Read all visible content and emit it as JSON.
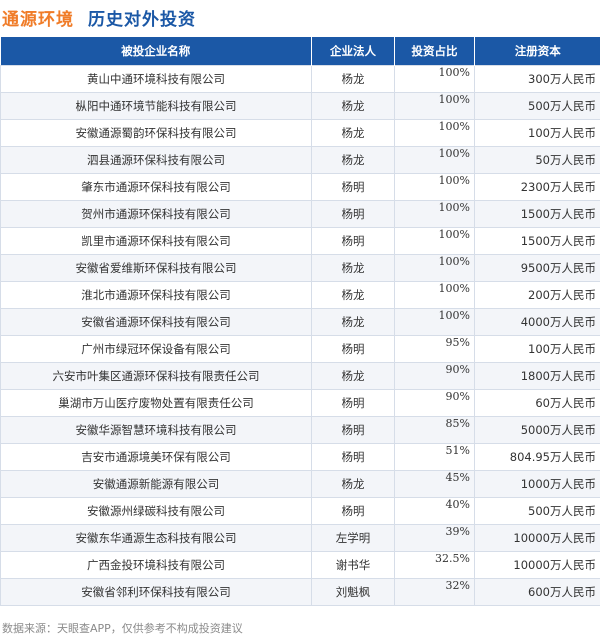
{
  "header": {
    "company": "通源环境",
    "subtitle": "历史对外投资"
  },
  "table": {
    "columns": [
      "被投企业名称",
      "企业法人",
      "投资占比",
      "注册资本"
    ],
    "rows": [
      {
        "name": "黄山中通环境科技有限公司",
        "person": "杨龙",
        "ratio": "100%",
        "capital": "300万人民币"
      },
      {
        "name": "枞阳中通环境节能科技有限公司",
        "person": "杨龙",
        "ratio": "100%",
        "capital": "500万人民币"
      },
      {
        "name": "安徽通源蜀韵环保科技有限公司",
        "person": "杨龙",
        "ratio": "100%",
        "capital": "100万人民币"
      },
      {
        "name": "泗县通源环保科技有限公司",
        "person": "杨龙",
        "ratio": "100%",
        "capital": "50万人民币"
      },
      {
        "name": "肇东市通源环保科技有限公司",
        "person": "杨明",
        "ratio": "100%",
        "capital": "2300万人民币"
      },
      {
        "name": "贺州市通源环保科技有限公司",
        "person": "杨明",
        "ratio": "100%",
        "capital": "1500万人民币"
      },
      {
        "name": "凯里市通源环保科技有限公司",
        "person": "杨明",
        "ratio": "100%",
        "capital": "1500万人民币"
      },
      {
        "name": "安徽省爱维斯环保科技有限公司",
        "person": "杨龙",
        "ratio": "100%",
        "capital": "9500万人民币"
      },
      {
        "name": "淮北市通源环保科技有限公司",
        "person": "杨龙",
        "ratio": "100%",
        "capital": "200万人民币"
      },
      {
        "name": "安徽省通源环保科技有限公司",
        "person": "杨龙",
        "ratio": "100%",
        "capital": "4000万人民币"
      },
      {
        "name": "广州市绿冠环保设备有限公司",
        "person": "杨明",
        "ratio": "95%",
        "capital": "100万人民币"
      },
      {
        "name": "六安市叶集区通源环保科技有限责任公司",
        "person": "杨龙",
        "ratio": "90%",
        "capital": "1800万人民币"
      },
      {
        "name": "巢湖市万山医疗废物处置有限责任公司",
        "person": "杨明",
        "ratio": "90%",
        "capital": "60万人民币"
      },
      {
        "name": "安徽华源智慧环境科技有限公司",
        "person": "杨明",
        "ratio": "85%",
        "capital": "5000万人民币"
      },
      {
        "name": "吉安市通源境美环保有限公司",
        "person": "杨明",
        "ratio": "51%",
        "capital": "804.95万人民币"
      },
      {
        "name": "安徽通源新能源有限公司",
        "person": "杨龙",
        "ratio": "45%",
        "capital": "1000万人民币"
      },
      {
        "name": "安徽源州绿碳科技有限公司",
        "person": "杨明",
        "ratio": "40%",
        "capital": "500万人民币"
      },
      {
        "name": "安徽东华通源生态科技有限公司",
        "person": "左学明",
        "ratio": "39%",
        "capital": "10000万人民币"
      },
      {
        "name": "广西金投环境科技有限公司",
        "person": "谢书华",
        "ratio": "32.5%",
        "capital": "10000万人民币"
      },
      {
        "name": "安徽省邻利环保科技有限公司",
        "person": "刘魁枫",
        "ratio": "32%",
        "capital": "600万人民币"
      }
    ]
  },
  "footer": "数据来源：天眼查APP，仅供参考不构成投资建议"
}
